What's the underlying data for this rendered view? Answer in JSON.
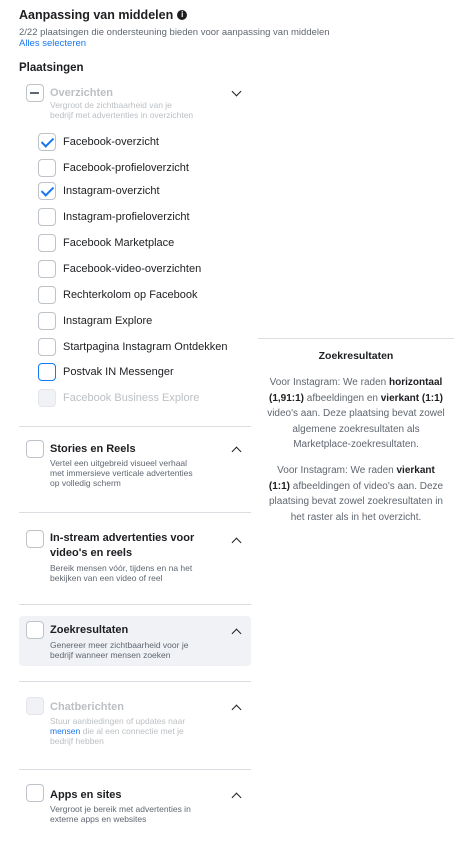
{
  "header": {
    "title": "Aanpassing van middelen",
    "subtitle": "2/22 plaatsingen die ondersteuning bieden voor aanpassing van middelen",
    "select_all": "Alles selecteren"
  },
  "placements_heading": "Plaatsingen",
  "feeds": {
    "title": "Overzichten",
    "desc_line1": "Vergroot de zichtbaarheid van je",
    "desc_line2": "bedrijf met advertenties in overzichten",
    "items": [
      {
        "label": "Facebook-overzicht",
        "checked": true
      },
      {
        "label": "Facebook-profieloverzicht",
        "checked": false
      },
      {
        "label": "Instagram-overzicht",
        "checked": true
      },
      {
        "label": "Instagram-profieloverzicht",
        "checked": false
      },
      {
        "label": "Facebook Marketplace",
        "checked": false
      },
      {
        "label": "Facebook-video-overzichten",
        "checked": false
      },
      {
        "label": "Rechterkolom op Facebook",
        "checked": false
      },
      {
        "label": "Instagram Explore",
        "checked": false
      },
      {
        "label": "Startpagina Instagram Ontdekken",
        "checked": false
      },
      {
        "label": "Postvak IN Messenger",
        "checked": false
      },
      {
        "label": "Facebook Business Explore",
        "checked": false
      }
    ]
  },
  "stories": {
    "title": "Stories en Reels",
    "desc_line1": "Vertel een uitgebreid visueel verhaal",
    "desc_line2": "met immersieve verticale advertenties",
    "desc_line3": "op volledig scherm"
  },
  "instream": {
    "title_line1": "In-stream advertenties voor",
    "title_line2": "video's en reels",
    "desc_line1": "Bereik mensen vóór, tijdens en na het",
    "desc_line2": "bekijken van een video of reel"
  },
  "search": {
    "title": "Zoekresultaten",
    "desc_line1": "Genereer meer zichtbaarheid voor je",
    "desc_line2": "bedrijf wanneer mensen zoeken"
  },
  "messages": {
    "title": "Chatberichten",
    "desc_line1": "Stuur aanbiedingen of updates naar",
    "desc_link": "mensen",
    "desc_line2_rest": " die al een connectie met je",
    "desc_line3": "bedrijf hebben"
  },
  "apps": {
    "title": "Apps en sites",
    "desc_line1": "Vergroot je bereik met advertenties in",
    "desc_line2": "externe apps en websites"
  },
  "panel": {
    "title": "Zoekresultaten",
    "p1": {
      "a": "Voor Instagram: We raden ",
      "b1": "horizontaal",
      "b2": "(1,91:1)",
      "c": " afbeeldingen en ",
      "b3": "vierkant (1:1)",
      "l3": "video's aan. Deze plaatsing bevat zowel",
      "l4": "algemene zoekresultaten als",
      "l5": "Marketplace-zoekresultaten."
    },
    "p2": {
      "a": "Voor Instagram: We raden ",
      "b1": "vierkant",
      "b2": "(1:1)",
      "c": " afbeeldingen of video's aan. Deze",
      "l3": "plaatsing bevat zowel zoekresultaten in",
      "l4": "het raster als in het overzicht."
    }
  },
  "colors": {
    "accent": "#1877f2",
    "text": "#1c1e21",
    "muted": "#606770"
  }
}
